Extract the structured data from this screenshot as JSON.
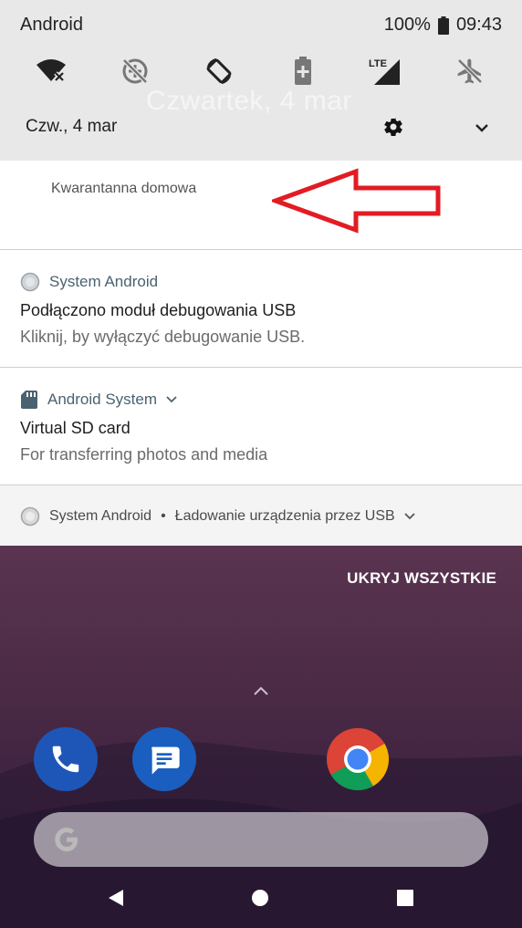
{
  "status_bar": {
    "carrier": "Android",
    "battery": "100%",
    "time": "09:43"
  },
  "quick_settings": {
    "tiles": [
      "wifi-off-icon",
      "data-saver-off-icon",
      "auto-rotate-icon",
      "battery-saver-icon",
      "lte-signal-icon",
      "airplane-mode-icon"
    ],
    "date_faded": "Czwartek, 4 mar",
    "date": "Czw., 4 mar"
  },
  "notifications": {
    "quarantine": {
      "title": "Kwarantanna domowa"
    },
    "usb_debug": {
      "app": "System Android",
      "title": "Podłączono moduł debugowania USB",
      "text": "Kliknij, by wyłączyć debugowanie USB."
    },
    "sd_card": {
      "app": "Android System",
      "title": "Virtual SD card",
      "text": "For transferring photos and media"
    },
    "charging": {
      "app": "System Android",
      "separator": "•",
      "text": "Ładowanie urządzenia przez USB"
    }
  },
  "hide_all": "UKRYJ WSZYSTKIE",
  "colors": {
    "annotation_arrow": "#e31b23",
    "qs_background": "#e8e8e8",
    "notification_bg": "#ffffff"
  }
}
